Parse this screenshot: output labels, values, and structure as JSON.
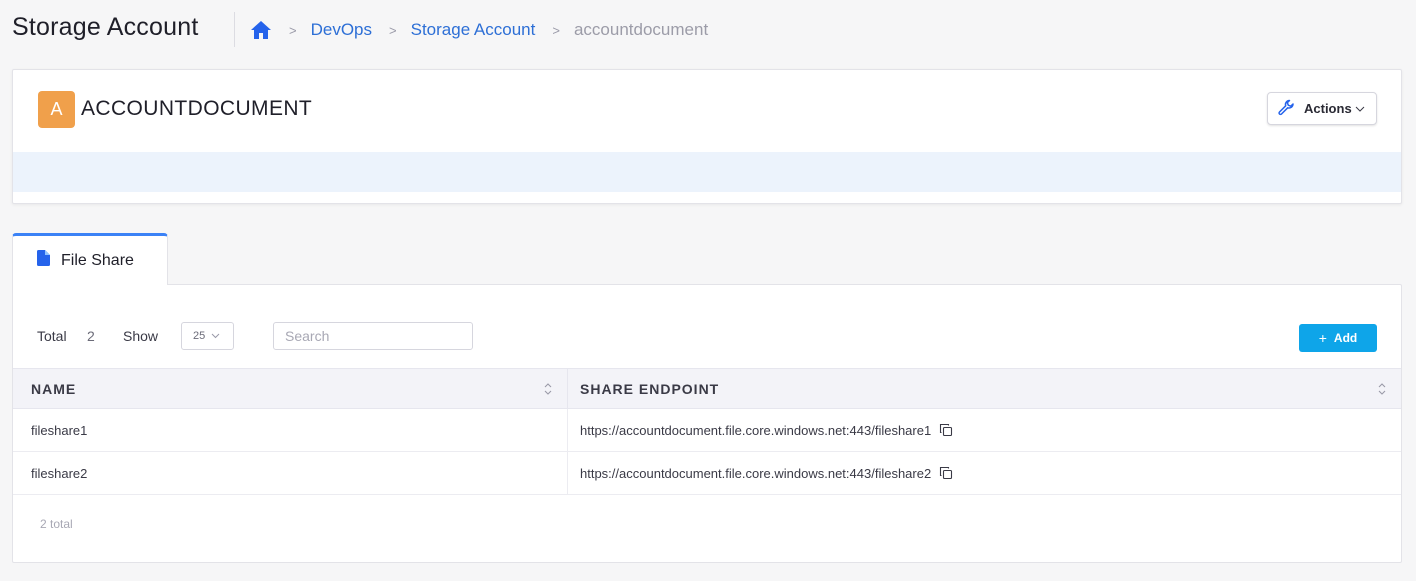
{
  "header": {
    "title": "Storage Account",
    "breadcrumb": [
      "DevOps",
      "Storage Account",
      "accountdocument"
    ]
  },
  "account": {
    "avatar_letter": "A",
    "name": "ACCOUNTDOCUMENT",
    "avatar_color": "#f0a04b",
    "actions_label": "Actions"
  },
  "tab": {
    "label": "File Share",
    "icon": "file-icon"
  },
  "toolbar": {
    "total_label": "Total",
    "total_value": "2",
    "show_label": "Show",
    "page_size": "25",
    "search_placeholder": "Search",
    "add_label": "Add"
  },
  "table": {
    "columns": [
      "NAME",
      "SHARE ENDPOINT"
    ],
    "rows": [
      {
        "name": "fileshare1",
        "endpoint": "https://accountdocument.file.core.windows.net:443/fileshare1"
      },
      {
        "name": "fileshare2",
        "endpoint": "https://accountdocument.file.core.windows.net:443/fileshare2"
      }
    ]
  },
  "footer": {
    "total_text": "2 total"
  },
  "colors": {
    "accent": "#2d6fd6",
    "add_button": "#0ea5e9",
    "tab_border": "#3b82f6",
    "band": "#ecf3fc"
  }
}
